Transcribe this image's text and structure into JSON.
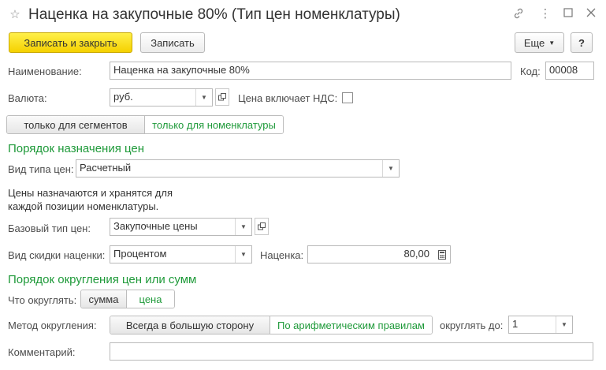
{
  "header": {
    "title": "Наценка на закупочные 80% (Тип цен номенклатуры)",
    "icons": [
      "star-icon",
      "link-icon",
      "more-icon",
      "maximize-icon",
      "close-icon"
    ]
  },
  "toolbar": {
    "save_close_label": "Записать и закрыть",
    "save_label": "Записать",
    "more_label": "Еще",
    "help_label": "?"
  },
  "form": {
    "name_label": "Наименование:",
    "name_value": "Наценка на закупочные 80%",
    "code_label": "Код:",
    "code_value": "00008",
    "currency_label": "Валюта:",
    "currency_value": "руб.",
    "vat_label": "Цена включает НДС:",
    "vat_checked": false,
    "segment_toggle": {
      "options": [
        "только для сегментов",
        "только для номенклатуры"
      ],
      "selected": "только для номенклатуры"
    }
  },
  "pricing": {
    "section_title": "Порядок назначения цен",
    "price_type_kind_label": "Вид типа цен:",
    "price_type_kind_value": "Расчетный",
    "note_line1": "Цены назначаются и хранятся для",
    "note_line2": "каждой позиции номенклатуры.",
    "base_type_label": "Базовый тип цен:",
    "base_type_value": "Закупочные цены",
    "discount_kind_label": "Вид скидки наценки:",
    "discount_kind_value": "Процентом",
    "markup_label": "Наценка:",
    "markup_value": "80,00"
  },
  "rounding": {
    "section_title": "Порядок округления цен или сумм",
    "what_label": "Что округлять:",
    "what_options": [
      "сумма",
      "цена"
    ],
    "what_selected": "цена",
    "method_label": "Метод округления:",
    "method_options": [
      "Всегда в большую сторону",
      "По арифметическим правилам"
    ],
    "method_selected": "По арифметическим правилам",
    "round_to_label": "округлять до:",
    "round_to_value": "1",
    "comment_label": "Комментарий:",
    "comment_value": ""
  },
  "colors": {
    "accent_green": "#1f9a3a",
    "primary_button": "#f5d100"
  }
}
